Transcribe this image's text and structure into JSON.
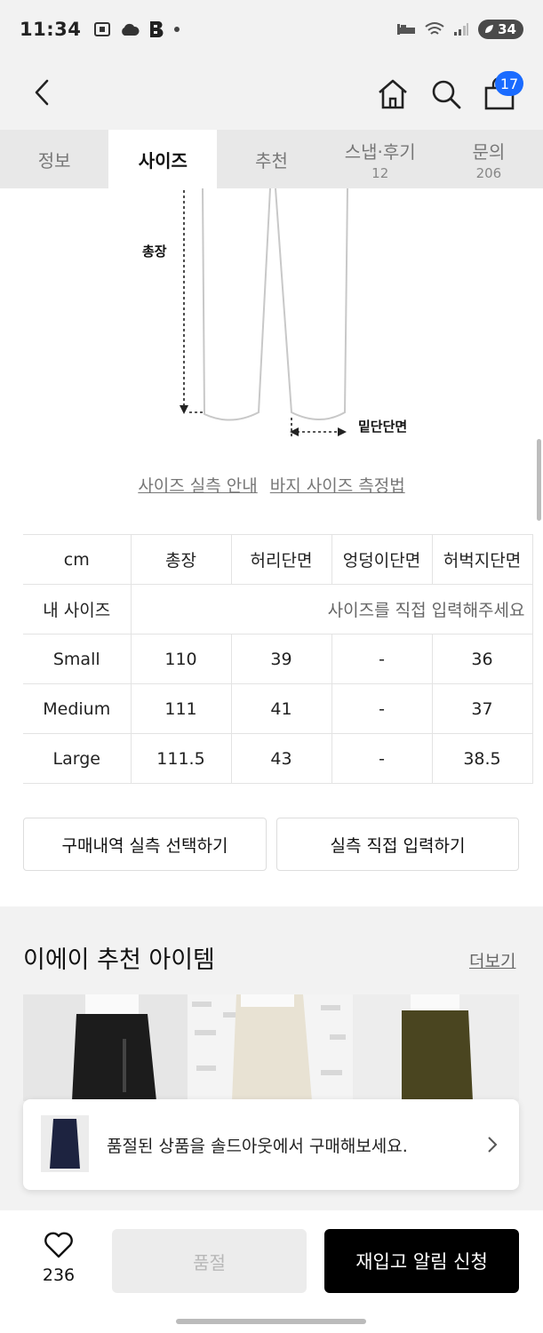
{
  "status_bar": {
    "time": "11:34",
    "battery": "34"
  },
  "header": {
    "cart_count": "17"
  },
  "tabs": [
    {
      "label": "정보",
      "count": ""
    },
    {
      "label": "사이즈",
      "count": ""
    },
    {
      "label": "추천",
      "count": ""
    },
    {
      "label": "스냅·후기",
      "count": "12"
    },
    {
      "label": "문의",
      "count": "206"
    }
  ],
  "diagram": {
    "length_label": "총장",
    "hem_label": "밑단단면"
  },
  "links": {
    "size_guide": "사이즈 실측 안내",
    "measure_method": "바지 사이즈 측정법"
  },
  "size_table": {
    "headers": [
      "cm",
      "총장",
      "허리단면",
      "엉덩이단면",
      "허벅지단면"
    ],
    "my_size_label": "내 사이즈",
    "my_size_placeholder": "사이즈를 직접 입력해주세요",
    "rows": [
      {
        "size": "Small",
        "values": [
          "110",
          "39",
          "-",
          "36"
        ]
      },
      {
        "size": "Medium",
        "values": [
          "111",
          "41",
          "-",
          "37"
        ]
      },
      {
        "size": "Large",
        "values": [
          "111.5",
          "43",
          "-",
          "38.5"
        ]
      }
    ]
  },
  "buttons": {
    "select_history": "구매내역 실측 선택하기",
    "direct_input": "실측 직접 입력하기"
  },
  "recommend": {
    "title": "이에이 추천 아이템",
    "more": "더보기"
  },
  "soldout_banner": {
    "text": "품절된 상품을 솔드아웃에서 구매해보세요."
  },
  "bottom": {
    "like_count": "236",
    "soldout_label": "품절",
    "restock_label": "재입고 알림 신청"
  },
  "colors": {
    "accent": "#1a6bff",
    "primary_button": "#000000"
  }
}
